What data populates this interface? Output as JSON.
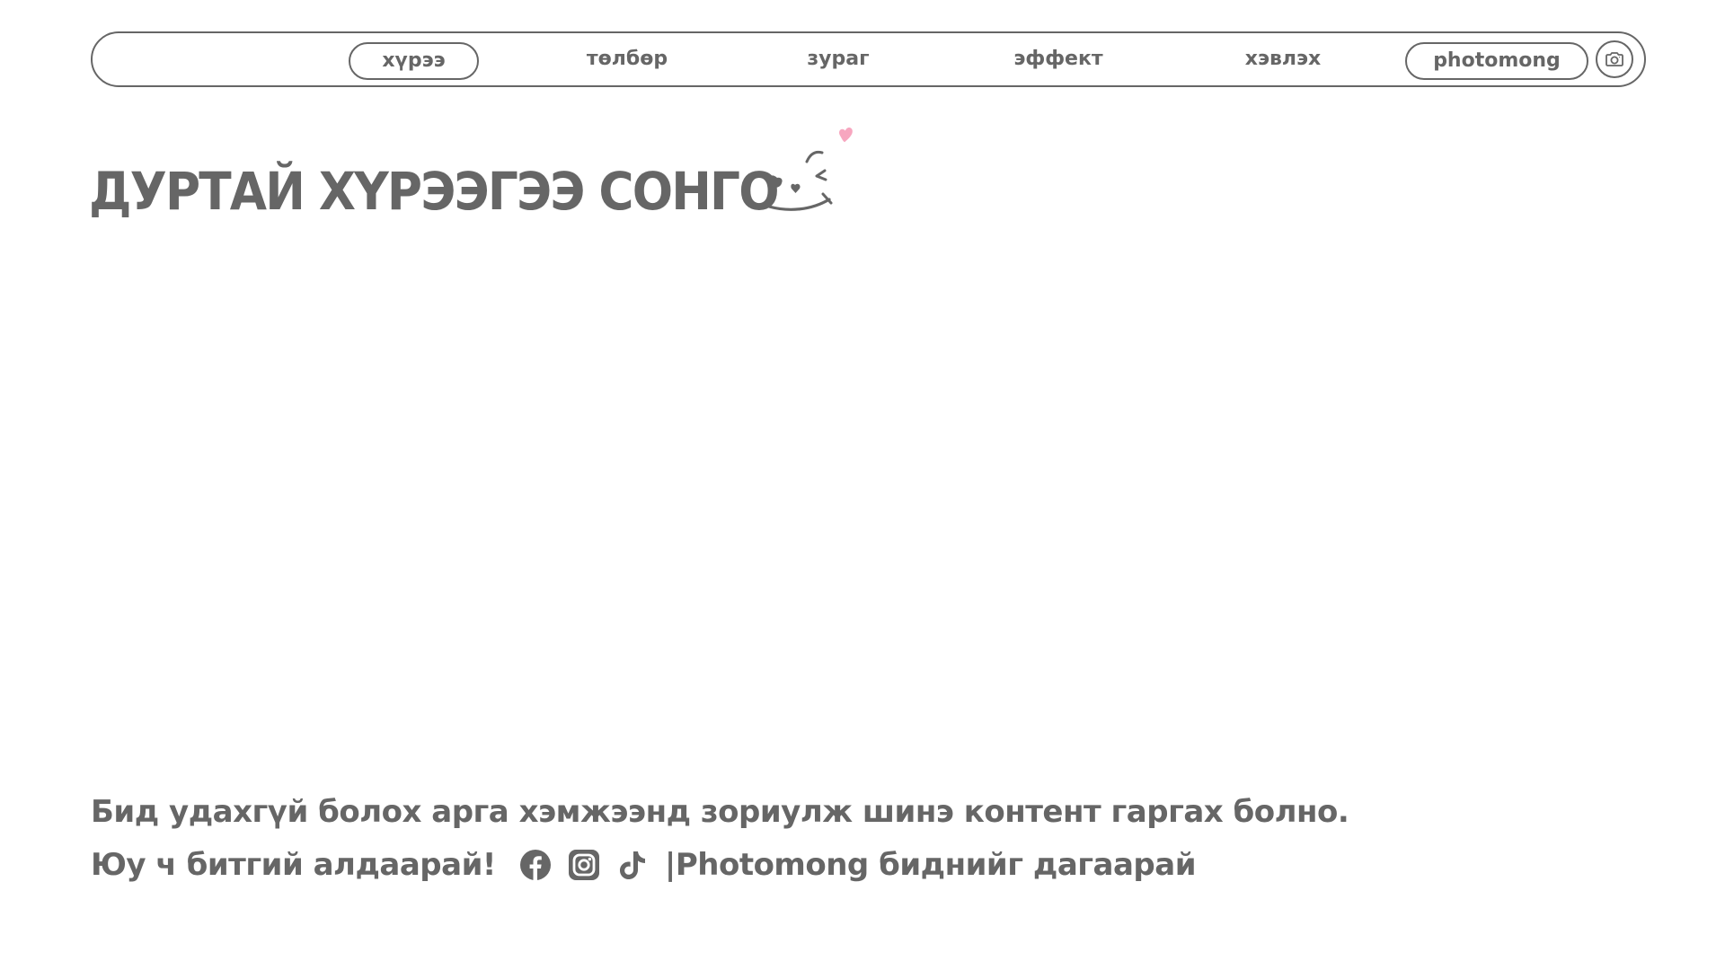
{
  "nav": {
    "items": [
      {
        "label": "хүрээ",
        "active": true
      },
      {
        "label": "төлбөр",
        "active": false
      },
      {
        "label": "зураг",
        "active": false
      },
      {
        "label": "эффект",
        "active": false
      },
      {
        "label": "хэвлэх",
        "active": false
      }
    ],
    "brand_label": "photomong",
    "camera_icon": "camera-icon"
  },
  "main": {
    "title": "ДУРТАЙ ХҮРЭЭГЭЭ СОНГО",
    "title_decoration_icon": "wink-face-icon"
  },
  "footer": {
    "line1": "Бид удахгүй болох арга хэмжээнд зориулж шинэ контент гаргах болно.",
    "line2_prefix": "Юу ч битгий алдаарай!",
    "social_icons": [
      "facebook-icon",
      "instagram-icon",
      "tiktok-icon"
    ],
    "line2_suffix": "|Photomong биднийг дагаарай"
  },
  "colors": {
    "text": "#666666",
    "accent_heart": "#f7a6bf",
    "background": "#ffffff"
  }
}
